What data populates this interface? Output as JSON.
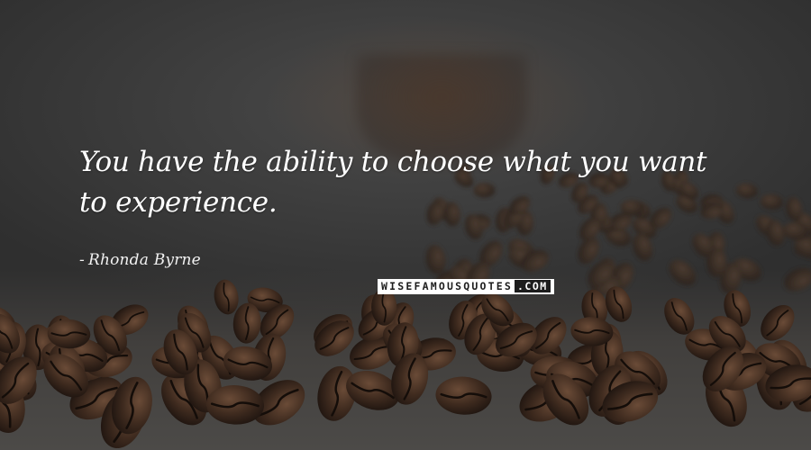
{
  "quote": {
    "text_line1": "You have the ability to choose what you want",
    "text_line2": "to experience.",
    "author": "Rhonda Byrne"
  },
  "watermark": {
    "left": "WISEFAMOUSQUOTES",
    "right": ".COM"
  },
  "colors": {
    "background": "#3a3a3a",
    "text": "#ffffff",
    "bean": "#3b2a20"
  }
}
